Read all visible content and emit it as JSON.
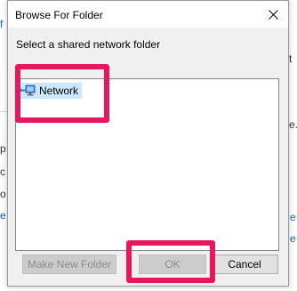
{
  "background": {
    "left_fragments": [
      "f",
      "p",
      "c",
      "o",
      "e"
    ],
    "right_fragments": [
      "t",
      "e.",
      "e",
      "e"
    ]
  },
  "dialog": {
    "title": "Browse For Folder",
    "instruction": "Select a shared network folder",
    "tree": {
      "items": [
        {
          "label": "Network",
          "icon": "network-icon",
          "selected": true
        }
      ]
    },
    "buttons": {
      "make_new_folder": {
        "label": "Make New Folder",
        "enabled": false
      },
      "ok": {
        "label": "OK",
        "enabled": false
      },
      "cancel": {
        "label": "Cancel",
        "enabled": true
      }
    }
  },
  "annotations": {
    "highlight_color": "#e8175d"
  }
}
